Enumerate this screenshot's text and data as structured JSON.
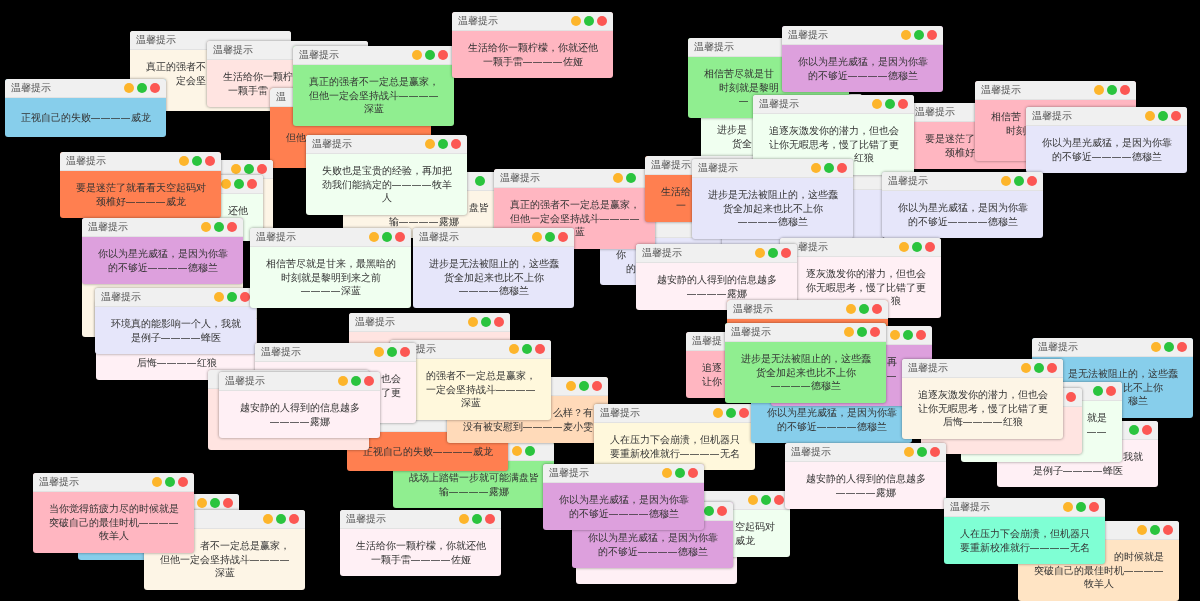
{
  "windows": [
    {
      "title": "温馨提示",
      "color": "#fdf5e6",
      "message_parts": [
        "真正的强者不",
        "定会坚"
      ]
    },
    {
      "title": "温馨提示",
      "color": "#87ceeb",
      "message": "正视自己的失败————威龙"
    },
    {
      "title": "温馨提示",
      "color": "#ffe4e1",
      "message_parts": [
        "生活给你一颗柠",
        "一颗手雷"
      ]
    },
    {
      "title": "温馨提示",
      "color": "#90ee90",
      "message": "真正的强者不一定总是赢家，但他一定会坚持战斗————深蓝"
    },
    {
      "title": "温",
      "color": "#ff7f50",
      "message_parts": [
        "但他"
      ]
    },
    {
      "title": "温馨提示",
      "color": "#ffb6c1",
      "message": "生活给你一颗柠檬，你就还他一颗手雷————佐娅"
    },
    {
      "title": "温馨提示",
      "color": "#90ee90",
      "message_parts": [
        "相信苦尽就是甘",
        "时刻就是黎明",
        "—"
      ]
    },
    {
      "title": "温馨提示",
      "color": "#dda0dd",
      "message": "你以为星光威猛，是因为你靠的不够近————德穆兰"
    },
    {
      "title": "温馨提示",
      "color": "#ff7f50",
      "message": "要是迷茫了就看看天空起码对颈椎好————威龙"
    },
    {
      "color": "#fdf5e6"
    },
    {
      "color": "#f0fff0",
      "message_parts": [
        "还他"
      ]
    },
    {
      "title": "温馨提示",
      "color": "#f0fff0",
      "message": "失败也是宝贵的经验，再加把劲我们能搞定的————牧羊人"
    },
    {
      "title": "温馨提示",
      "color": "#dda0dd",
      "message": "你以为星光威猛，是因为你靠的不够近————德穆兰"
    },
    {
      "color": "#fdf5e6"
    },
    {
      "title": "温馨提示",
      "color": "#e6e6fa",
      "message": "环境真的能影响一个人，我就是例子————蜂医"
    },
    {
      "color": "#fdf5e6",
      "message_parts": [
        "盘皆",
        "输————露娜"
      ]
    },
    {
      "title": "温馨提示",
      "color": "#f0fff0",
      "message": "相信苦尽就是甘来，最黑暗的时刻就是黎明到来之前————深蓝"
    },
    {
      "title": "温馨提示",
      "color": "#ffb6c1",
      "message_parts": [
        "真正的强者不一定总是赢家，",
        "但他一定会坚持战斗————",
        "蓝"
      ]
    },
    {
      "title": "温馨提示",
      "color": "#e6e6fa",
      "message": "进步是无法被阻止的，这些蠢货全加起来也比不上你————德穆兰"
    },
    {
      "title": "温馨提示",
      "color": "#ff7f50",
      "message_parts": [
        "生活给",
        "一"
      ]
    },
    {
      "color": "#f0fff0",
      "message_parts": [
        "进步是",
        "货全"
      ]
    },
    {
      "title": "温馨提示",
      "color": "#f0fff0",
      "message_parts": [
        "追逐灰激发你的潜力，但也会",
        "让你无暇思考，慢了比错了更",
        "红狼"
      ]
    },
    {
      "title": "温馨提示",
      "color": "#ffb6c1",
      "message_parts": [
        "要是迷茫了",
        "颈椎好"
      ]
    },
    {
      "title": "温馨提示",
      "color": "#ffb6c1",
      "message_parts": [
        "相信苦",
        "时刻"
      ]
    },
    {
      "title": "温馨提示",
      "color": "#e6e6fa",
      "message": "你以为星光威猛，是因为你靠的不够近————德穆兰"
    },
    {
      "title": "温馨提示",
      "color": "#e6e6fa",
      "message": "进步是无法被阻止的，这些蠢货全加起来也比不上你————德穆兰"
    },
    {
      "color": "#e6e6fa"
    },
    {
      "title": "温馨提示",
      "color": "#e6e6fa",
      "message": "你以为星光威猛，是因为你靠的不够近————德穆兰"
    },
    {
      "color": "#e6e6fa",
      "message_parts": [
        "你",
        "的"
      ]
    },
    {
      "title": "温馨提示",
      "color": "#fff0f5",
      "message": "越安静的人得到的信息越多————露娜"
    },
    {
      "title": "温馨提示",
      "color": "#ff7f50"
    },
    {
      "title": "馨提示",
      "color": "#fff0f5",
      "message_parts": [
        "逐灰激发你的潜力，但也会",
        "你无暇思考，慢了比错了更",
        "狼"
      ]
    },
    {
      "title": "温馨提示",
      "color": "#ffe4e1"
    },
    {
      "color": "#fff0f5",
      "message_parts": [
        "后悔————红狼"
      ]
    },
    {
      "title": "温馨提示",
      "color": "#fff0f5",
      "message_parts": [
        "也会",
        "了更"
      ]
    },
    {
      "title": "温馨提示",
      "color": "#fff0f5",
      "message": "越安静的人得到的信息越多————露娜"
    },
    {
      "color": "#ffe4e1"
    },
    {
      "title": "提示",
      "color": "#fff8dc",
      "message_parts": [
        "的强者不一定总是赢家，",
        "一定会坚持战斗————",
        "深蓝"
      ]
    },
    {
      "color": "#ffdab9",
      "message_parts": [
        "么样？有",
        "没有被安慰到————麦小雯"
      ]
    },
    {
      "title": "温馨提",
      "color": "#ffb6c1",
      "message_parts": [
        "追逐",
        "让你"
      ]
    },
    {
      "title": "温馨提示",
      "color": "#90ee90",
      "message": "进步是无法被阻止的，这些蠢货全加起来也比不上你————德穆兰"
    },
    {
      "color": "#dda0dd",
      "message_parts": [
        "再",
        "—"
      ]
    },
    {
      "color": "#ff7f50",
      "message": "正视自己的失败————威龙"
    },
    {
      "title": "温馨提示",
      "color": "#fff8dc",
      "message": "人在压力下会崩溃，但机器只要重新校准就行————无名"
    },
    {
      "color": "#87ceeb",
      "message": "你以为星光威猛，是因为你靠的不够近————德穆兰"
    },
    {
      "title": "温馨提示",
      "color": "#fdf5e6",
      "message": "追逐灰激发你的潜力，但也会让你无暇思考，慢了比错了更后悔————红狼"
    },
    {
      "title": "温馨提示",
      "color": "#87ceeb",
      "message_parts": [
        "是无法被阻止的，这些蠢",
        "比不上你",
        "穆兰"
      ]
    },
    {
      "color": "#f0fff0",
      "message_parts": [
        "就是",
        "——"
      ]
    },
    {
      "color": "#ffe4e1"
    },
    {
      "title": "温馨提示",
      "color": "#ffb6c1",
      "message": "当你觉得筋疲力尽的时候就是突破自己的最佳时机————牧羊人"
    },
    {
      "color": "#87ceeb"
    },
    {
      "color": "#90ee90",
      "message": "战场上踏错一步就可能满盘皆输————露娜"
    },
    {
      "color": "#fdf5e6",
      "message_parts": [
        "者不一定总是赢家，",
        "但他一定会坚持战斗————",
        "深蓝"
      ]
    },
    {
      "title": "温馨提示",
      "color": "#fff0f5",
      "message": "生活给你一颗柠檬，你就还他一颗手雷————佐娅"
    },
    {
      "title": "温馨提示",
      "color": "#dda0dd",
      "message": "你以为星光威猛，是因为你靠的不够近————德穆兰"
    },
    {
      "title": "温馨提示",
      "color": "#fff0f5",
      "message": "越安静的人得到的信息越多————露娜"
    },
    {
      "color": "#fff0f5",
      "message_parts": [
        "我就",
        "是例子————蜂医"
      ]
    },
    {
      "color": "#dda0dd",
      "message": "你以为星光威猛，是因为你靠的不够近————德穆兰"
    },
    {
      "color": "#fff0f5"
    },
    {
      "color": "#f0fff0",
      "message_parts": [
        "空起码对",
        "威龙"
      ]
    },
    {
      "title": "温馨提示",
      "color": "#7fffd4",
      "message": "人在压力下会崩溃，但机器只要重新校准就行————无名"
    },
    {
      "color": "#ffe4c4",
      "message_parts": [
        "的时候就是",
        "突破自己的最佳时机————",
        "牧羊人"
      ]
    }
  ]
}
